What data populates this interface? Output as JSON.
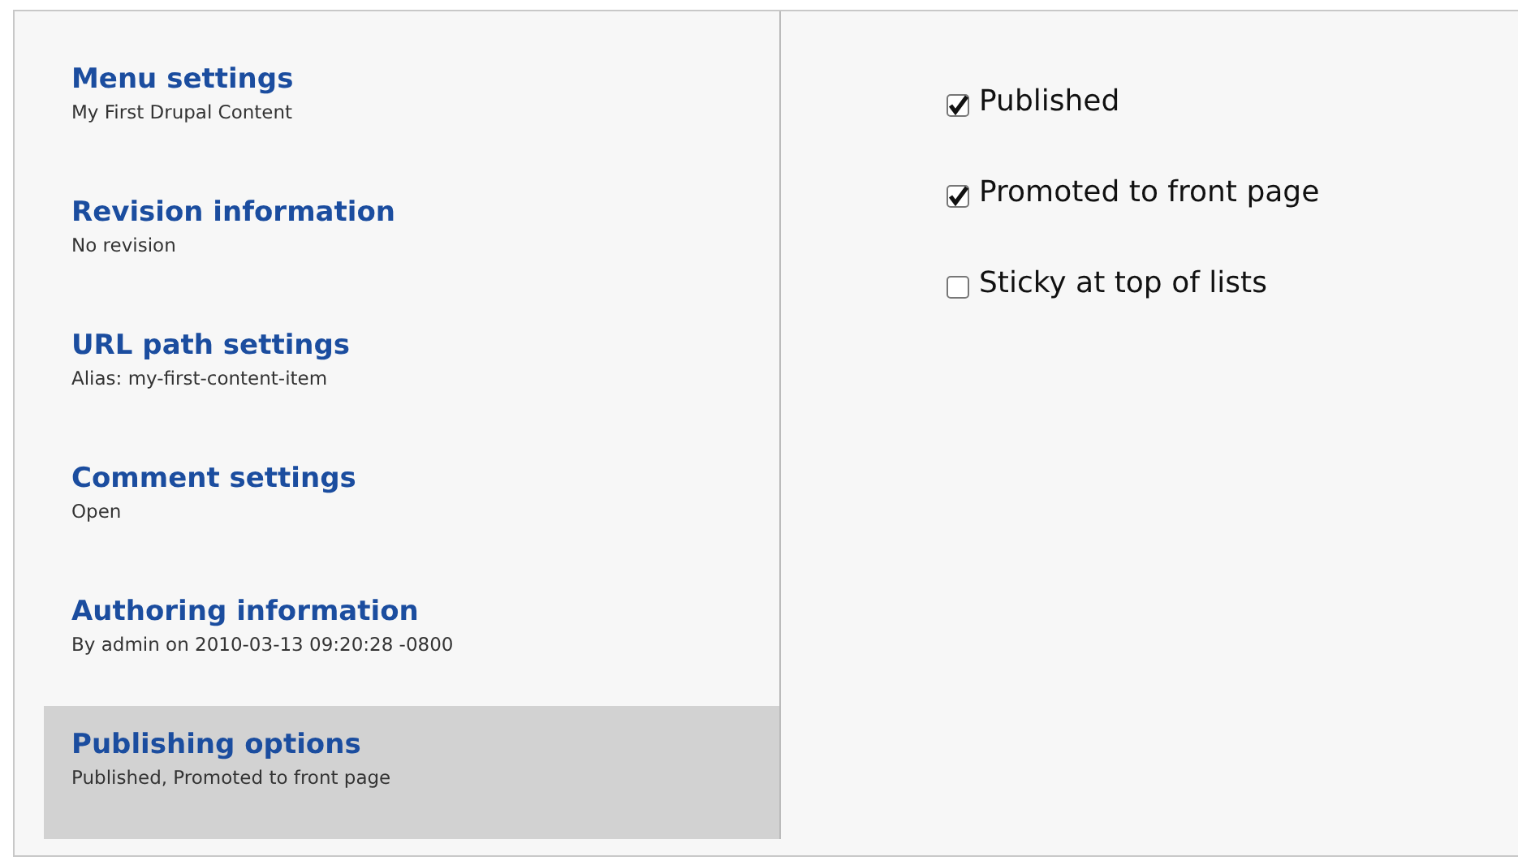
{
  "tabs": [
    {
      "title": "Menu settings",
      "summary": "My First Drupal Content",
      "selected": false
    },
    {
      "title": "Revision information",
      "summary": "No revision",
      "selected": false
    },
    {
      "title": "URL path settings",
      "summary": "Alias: my-first-content-item",
      "selected": false
    },
    {
      "title": "Comment settings",
      "summary": "Open",
      "selected": false
    },
    {
      "title": "Authoring information",
      "summary": "By admin on 2010-03-13 09:20:28 -0800",
      "selected": false
    },
    {
      "title": "Publishing options",
      "summary": "Published, Promoted to front page",
      "selected": true
    }
  ],
  "options": [
    {
      "label": "Published",
      "checked": true
    },
    {
      "label": "Promoted to front page",
      "checked": true
    },
    {
      "label": "Sticky at top of lists",
      "checked": false
    }
  ]
}
